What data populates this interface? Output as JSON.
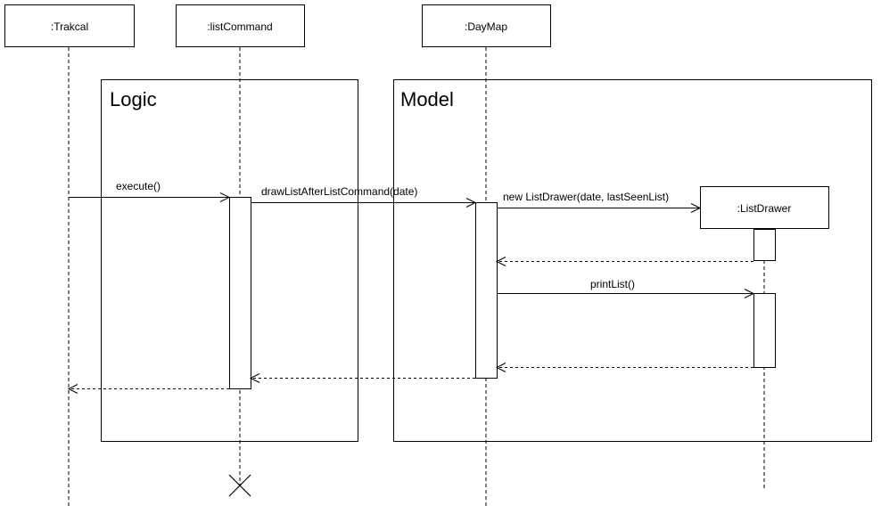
{
  "participants": {
    "trakcal": ":Trakcal",
    "listcommand": ":listCommand",
    "daymap": ":DayMap",
    "listdrawer": ":ListDrawer"
  },
  "frames": {
    "logic": "Logic",
    "model": "Model"
  },
  "messages": {
    "execute": "execute()",
    "draw_list": "drawListAfterListCommand(date)",
    "new_list_drawer": "new ListDrawer(date, lastSeenList)",
    "print_list": "printList()"
  }
}
